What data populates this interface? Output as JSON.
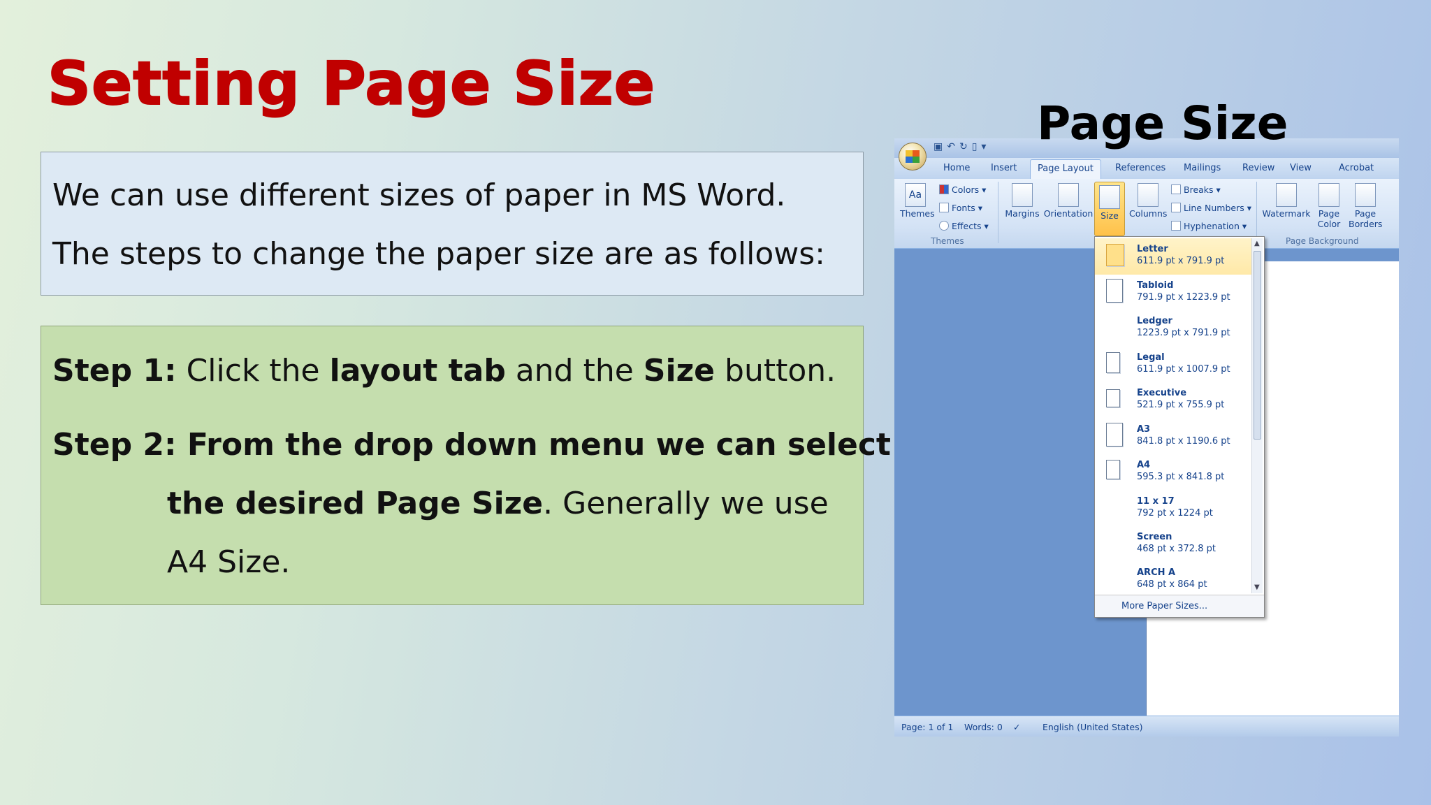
{
  "slide": {
    "title": "Setting Page Size",
    "intro_line1": "We can use different sizes of paper in MS Word.",
    "intro_line2": "The steps to change the paper size are as follows:",
    "step1_label": "Step 1:",
    "step1_a": " Click the ",
    "step1_b": "layout tab",
    "step1_c": " and the ",
    "step1_d": "Size",
    "step1_e": " button.",
    "step2_label": "Step 2: From the drop down menu we can select",
    "step2_line2_bold": "the desired Page Size",
    "step2_line2_rest": ". Generally we use",
    "step2_line3": "A4 Size.",
    "screenshot_heading": "Page Size"
  },
  "word": {
    "title_fragment": "Page Size",
    "tabs": [
      "Home",
      "Insert",
      "Page Layout",
      "References",
      "Mailings",
      "Review",
      "View",
      "Acrobat"
    ],
    "active_tab": "Page Layout",
    "ribbon": {
      "themes": "Themes",
      "colors": "Colors",
      "fonts": "Fonts",
      "effects": "Effects",
      "themes_group": "Themes",
      "margins": "Margins",
      "orientation": "Orientation",
      "size": "Size",
      "columns": "Columns",
      "breaks": "Breaks",
      "line_numbers": "Line Numbers",
      "hyphenation": "Hyphenation",
      "watermark": "Watermark",
      "page_color": "Page Color",
      "page_borders": "Page Borders",
      "page_background_group": "Page Background"
    },
    "size_menu": [
      {
        "name": "Letter",
        "dims": "611.9 pt x 791.9 pt"
      },
      {
        "name": "Tabloid",
        "dims": "791.9 pt x 1223.9 pt"
      },
      {
        "name": "Ledger",
        "dims": "1223.9 pt x 791.9 pt"
      },
      {
        "name": "Legal",
        "dims": "611.9 pt x 1007.9 pt"
      },
      {
        "name": "Executive",
        "dims": "521.9 pt x 755.9 pt"
      },
      {
        "name": "A3",
        "dims": "841.8 pt x 1190.6 pt"
      },
      {
        "name": "A4",
        "dims": "595.3 pt x 841.8 pt"
      },
      {
        "name": "11 x 17",
        "dims": "792 pt x 1224 pt"
      },
      {
        "name": "Screen",
        "dims": "468 pt x 372.8 pt"
      },
      {
        "name": "ARCH A",
        "dims": "648 pt x 864 pt"
      }
    ],
    "more_sizes": "More Paper Sizes...",
    "status": {
      "page": "Page: 1 of 1",
      "words": "Words: 0",
      "language": "English (United States)"
    }
  }
}
